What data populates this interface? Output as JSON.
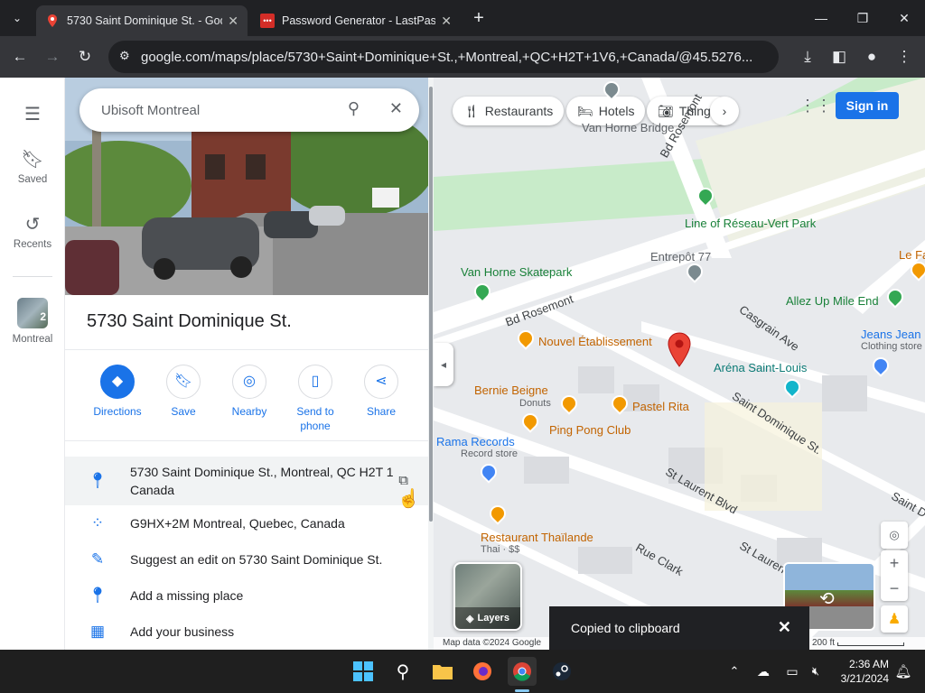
{
  "browser": {
    "tabs": [
      {
        "title": "5730 Saint Dominique St. - Goo",
        "active": true
      },
      {
        "title": "Password Generator - LastPass",
        "active": false
      }
    ],
    "new_tab": "+",
    "url": "google.com/maps/place/5730+Saint+Dominique+St.,+Montreal,+QC+H2T+1V6,+Canada/@45.5276..."
  },
  "rail": {
    "saved": "Saved",
    "recents": "Recents",
    "montreal": "Montreal",
    "montreal_count": "2"
  },
  "search": {
    "value": "Ubisoft Montreal"
  },
  "place": {
    "title": "5730 Saint Dominique St.",
    "actions": [
      "Directions",
      "Save",
      "Nearby",
      "Send to phone",
      "Share"
    ],
    "address": "5730 Saint Dominique St., Montreal, QC H2T 1",
    "address_line2": "Canada",
    "plus_code": "G9HX+2M Montreal, Quebec, Canada",
    "suggest_edit": "Suggest an edit on 5730 Saint Dominique St.",
    "add_missing": "Add a missing place",
    "add_business": "Add your business"
  },
  "map": {
    "chips": [
      "Restaurants",
      "Hotels",
      "Things"
    ],
    "sign_in": "Sign in",
    "labels": {
      "van_horne_bridge": "Van Horne Bridge",
      "bd_rosemont_ne": "Bd Rosemont",
      "line_reseau": "Line of Réseau-Vert Park",
      "entrepot": "Entrepôt 77",
      "le_fa": "Le Fa",
      "skatepark": "Van Horne Skatepark",
      "bd_rosemont_w": "Bd Rosemont",
      "casgrain": "Casgrain Ave",
      "allez_up": "Allez Up Mile End",
      "jeans": "Jeans Jean",
      "clothing": "Clothing store",
      "nouvel": "Nouvel Établissement",
      "arena": "Aréna Saint-Louis",
      "saint_dom_1": "Saint Dominique St.",
      "bernie": "Bernie Beigne",
      "donuts": "Donuts",
      "pastel": "Pastel Rita",
      "ping_pong": "Ping Pong Club",
      "rama": "Rama Records",
      "record_store": "Record store",
      "st_laurent_1": "St Laurent Blvd",
      "saint_dom_2": "Saint D",
      "restaurant_thai": "Restaurant Thaïlande",
      "thai_price": "Thai · $$",
      "rue_clark": "Rue Clark",
      "st_laurent_2": "St Laurent Bl",
      "layers": "Layers",
      "map_data": "Map data ©2024 Google",
      "scale": "200 ft"
    }
  },
  "toast": {
    "text": "Copied to clipboard"
  },
  "taskbar": {
    "time": "2:36 AM",
    "date": "3/21/2024"
  },
  "colors": {
    "accent": "#1a73e8",
    "pin": "#ea4335",
    "park": "#c8ebc9",
    "orange_poi": "#f29900",
    "green_poi": "#34a853"
  }
}
